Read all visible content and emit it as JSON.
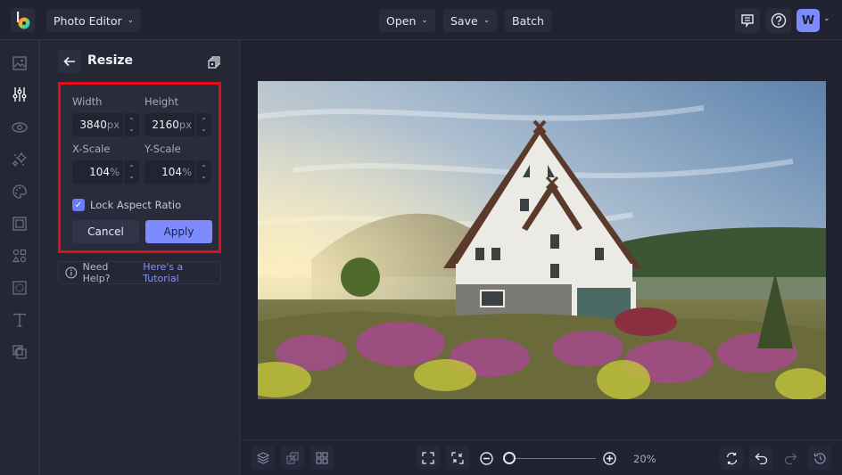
{
  "topbar": {
    "app_menu_label": "Photo Editor",
    "open_label": "Open",
    "save_label": "Save",
    "batch_label": "Batch",
    "avatar_initial": "W",
    "icons": [
      "feedback-icon",
      "help-icon"
    ]
  },
  "rail": {
    "items": [
      "image-icon",
      "adjustments-icon",
      "eye-icon",
      "sparkles-icon",
      "palette-icon",
      "frame-icon",
      "shapes-icon",
      "texture-icon",
      "text-icon",
      "overlay-icon"
    ],
    "active": "adjustments-icon"
  },
  "panel": {
    "title": "Resize",
    "width_label": "Width",
    "height_label": "Height",
    "width_value": "3840",
    "height_value": "2160",
    "px_unit": "px",
    "xscale_label": "X-Scale",
    "yscale_label": "Y-Scale",
    "xscale_value": "104",
    "yscale_value": "104",
    "pct_unit": "%",
    "lock_label": "Lock Aspect Ratio",
    "lock_checked": true,
    "cancel_label": "Cancel",
    "apply_label": "Apply",
    "help_text": "Need Help?",
    "help_link": "Here's a Tutorial"
  },
  "bottombar": {
    "zoom_label": "20%",
    "zoom_value_percent": 20
  },
  "colors": {
    "accent": "#7d8bff",
    "highlight_box": "#e30e17",
    "background": "#212330"
  }
}
